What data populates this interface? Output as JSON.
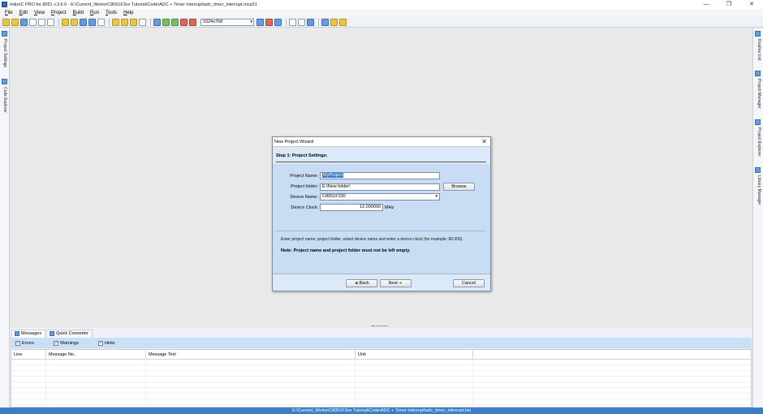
{
  "window": {
    "title": "mikroC PRO for 8051 v.3.6.0 - E:\\Current_Works\\C8051F3xx Tutorial\\Code\\ADC + Timer Interrupt\\adc_timer_interrupt.mcp51",
    "minimize": "—",
    "restore": "❐",
    "close": "✕"
  },
  "menu": [
    {
      "key": "F",
      "rest": "ile"
    },
    {
      "key": "E",
      "rest": "dit"
    },
    {
      "key": "V",
      "rest": "iew"
    },
    {
      "key": "P",
      "rest": "roject"
    },
    {
      "key": "B",
      "rest": "uild"
    },
    {
      "key": "R",
      "rest": "un"
    },
    {
      "key": "T",
      "rest": "ools"
    },
    {
      "key": "H",
      "rest": "elp"
    }
  ],
  "toolbar": {
    "resolution": "1024x768",
    "resolution_arrow": "▾"
  },
  "left_tabs": [
    "Project Settings",
    "Code Explorer"
  ],
  "right_tabs": [
    "Routine List",
    "Project Manager",
    "Project Explorer",
    "Library Manager"
  ],
  "dialog": {
    "title": "New Project Wizard",
    "close": "✕",
    "step": "Step 1: Project Settings:",
    "fields": {
      "project_name_label": "Project Name:",
      "project_name_value": "MyProject",
      "project_folder_label": "Project folder:",
      "project_folder_value": "E:\\New folder\\",
      "browse": "Browse",
      "device_name_label": "Device Name:",
      "device_name_value": "C8051F330",
      "device_arrow": "▾",
      "device_clock_label": "Device Clock:",
      "device_clock_value": "12.000000",
      "device_clock_unit": "MHz"
    },
    "info": "Enter project name, project folder, select device name and enter a device clock (for example: 80.000).",
    "note": "Note: Project name and project folder must not be left empty.",
    "buttons": {
      "back": "Back",
      "back_arrow": "◆",
      "next": "Next",
      "next_arrow": "➔",
      "cancel": "Cancel"
    }
  },
  "messages": {
    "tabs": [
      "Messages",
      "Quick Converter"
    ],
    "filters": [
      "Errors",
      "Warnings",
      "Hints"
    ],
    "check": "✓",
    "columns": [
      "Line",
      "Message No.",
      "Message Text",
      "Unit"
    ]
  },
  "status": {
    "path": "E:\\Current_Works\\C8051F3xx Tutorial\\Code\\ADC + Timer Interrupt\\adc_timer_interrupt.list"
  }
}
